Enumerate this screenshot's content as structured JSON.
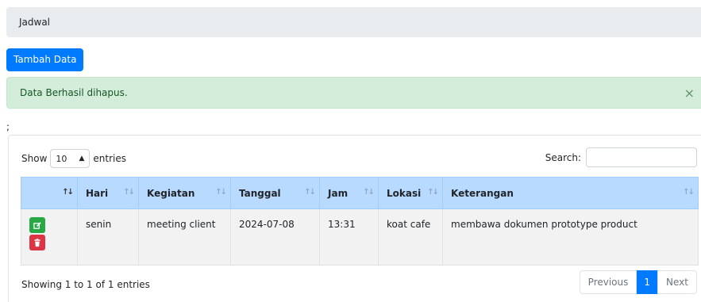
{
  "breadcrumb": {
    "title": "Jadwal"
  },
  "toolbar": {
    "add_label": "Tambah Data"
  },
  "alert": {
    "message": "Data Berhasil dihapus.",
    "close_glyph": "×"
  },
  "stray_text": ";",
  "datatable": {
    "length": {
      "prefix": "Show",
      "value": "10",
      "suffix": "entries"
    },
    "search": {
      "label": "Search:",
      "value": ""
    },
    "sort_glyph": "↑↓",
    "columns": [
      "",
      "Hari",
      "Kegiatan",
      "Tanggal",
      "Jam",
      "Lokasi",
      "Keterangan"
    ],
    "rows": [
      {
        "hari": "senin",
        "kegiatan": "meeting client",
        "tanggal": "2024-07-08",
        "jam": "13:31",
        "lokasi": "koat cafe",
        "keterangan": "membawa dokumen prototype product",
        "edit_icon": "edit-icon",
        "delete_icon": "trash-icon"
      }
    ],
    "info": "Showing 1 to 1 of 1 entries",
    "pagination": {
      "previous": "Previous",
      "current": "1",
      "next": "Next"
    }
  },
  "colors": {
    "primary": "#007bff",
    "success": "#28a745",
    "danger": "#dc3545",
    "alert_bg": "#d4edda",
    "header_bg": "#b8daff"
  }
}
